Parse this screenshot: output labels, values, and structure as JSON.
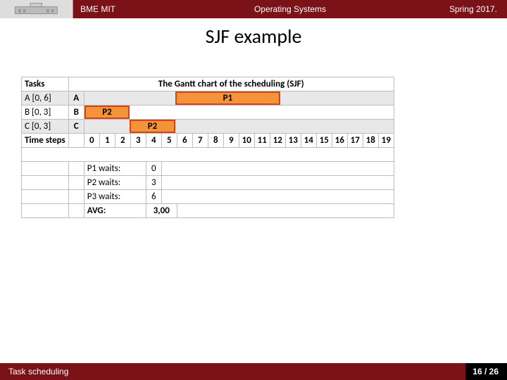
{
  "header": {
    "org": "BME MIT",
    "course": "Operating Systems",
    "semester": "Spring 2017."
  },
  "title": "SJF example",
  "table": {
    "h_tasks": "Tasks",
    "h_gantt": "The Gantt chart of the scheduling (SJF)",
    "rowA_label": "A [0, 6]",
    "rowA_t": "A",
    "rowA_bar": "P1",
    "rowB_label": "B [0, 3]",
    "rowB_t": "B",
    "rowB_bar": "P2",
    "rowC_label": "C [0, 3]",
    "rowC_t": "C",
    "rowC_bar": "P2",
    "time_label": "Time steps",
    "steps": [
      "0",
      "1",
      "2",
      "3",
      "4",
      "5",
      "6",
      "7",
      "8",
      "9",
      "10",
      "11",
      "12",
      "13",
      "14",
      "15",
      "16",
      "17",
      "18",
      "19"
    ],
    "waits": [
      {
        "label": "P1 waits:",
        "val": "0"
      },
      {
        "label": "P2 waits:",
        "val": "3"
      },
      {
        "label": "P3 waits:",
        "val": "6"
      }
    ],
    "avg_label": "AVG:",
    "avg_val": "3,00"
  },
  "footer": {
    "left": "Task scheduling",
    "right": "16 / 26"
  },
  "chart_data": {
    "type": "gantt",
    "title": "SJF example — Gantt chart of the scheduling (SJF)",
    "xlabel": "Time steps",
    "x_range": [
      0,
      19
    ],
    "tasks": [
      {
        "name": "A",
        "arrival": 0,
        "burst": 6,
        "bar_label": "P1",
        "start": 6,
        "end": 12
      },
      {
        "name": "B",
        "arrival": 0,
        "burst": 3,
        "bar_label": "P2",
        "start": 0,
        "end": 3
      },
      {
        "name": "C",
        "arrival": 0,
        "burst": 3,
        "bar_label": "P2",
        "start": 3,
        "end": 6
      }
    ],
    "waits": {
      "P1": 0,
      "P2": 3,
      "P3": 6
    },
    "average_wait": 3.0
  }
}
